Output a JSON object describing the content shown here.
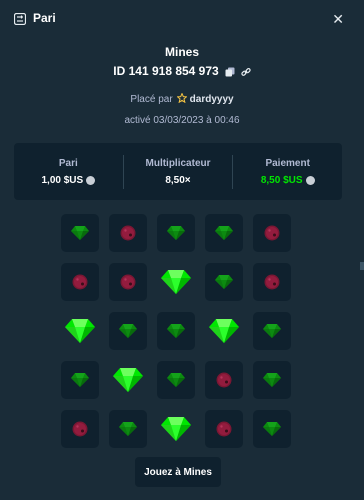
{
  "header": {
    "title": "Pari",
    "icon": "bet-slip-icon",
    "close_icon": "close-icon"
  },
  "bet": {
    "game": "Mines",
    "id": "ID 141 918 854 973",
    "placed_by_label": "Placé par",
    "user": "dardyyyy",
    "activated": "activé 03/03/2023 à 00:46"
  },
  "summary": {
    "bet_label": "Pari",
    "bet_value": "1,00 $US",
    "multiplier_label": "Multiplicateur",
    "multiplier_value": "8,50×",
    "payout_label": "Paiement",
    "payout_value": "8,50 $US"
  },
  "colors": {
    "background": "#1a2c38",
    "panel": "#0f212e",
    "gem": "#00e701",
    "mine": "#e0245e",
    "muted": "#b1bad3"
  },
  "grid": [
    [
      "gem-small",
      "mine-small",
      "gem-small",
      "gem-small",
      "mine-small"
    ],
    [
      "mine-small",
      "mine-small",
      "gem-big",
      "gem-small",
      "mine-small"
    ],
    [
      "gem-big",
      "gem-small",
      "gem-small",
      "gem-big",
      "gem-small"
    ],
    [
      "gem-small",
      "gem-big",
      "gem-small",
      "mine-small",
      "gem-small"
    ],
    [
      "mine-small",
      "gem-small",
      "gem-big",
      "mine-small",
      "gem-small"
    ]
  ],
  "play_button": "Jouez à Mines"
}
